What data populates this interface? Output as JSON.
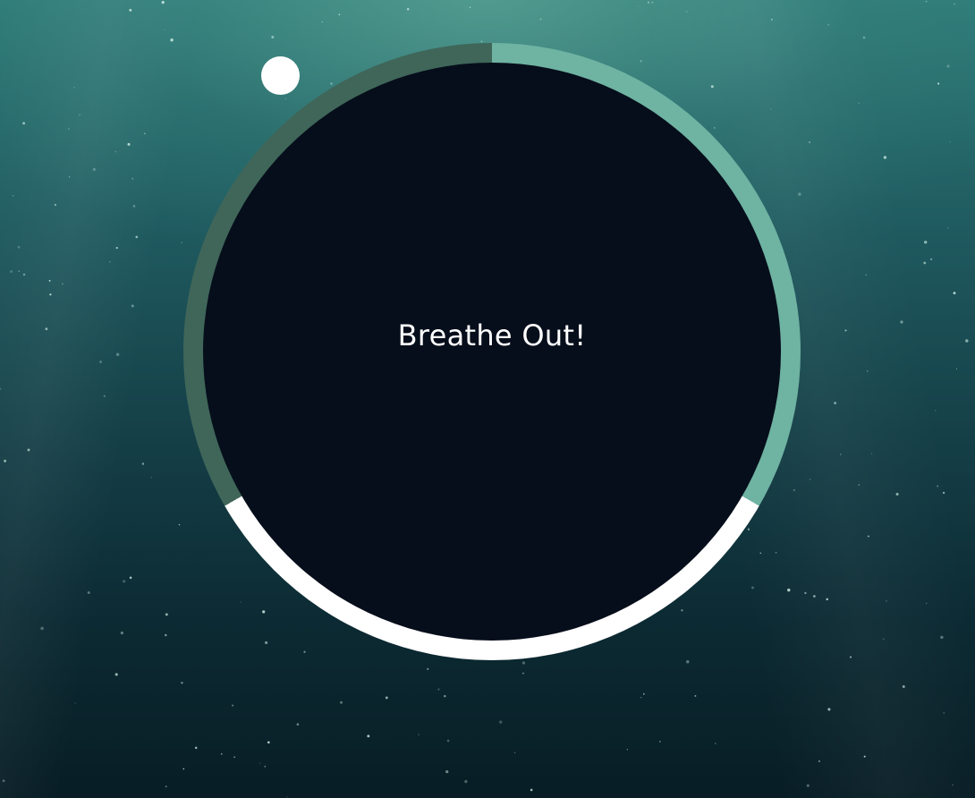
{
  "breathing": {
    "phase_text": "Breathe Out!",
    "segments": [
      {
        "phase": "breathe-in",
        "color": "#6fb3a2"
      },
      {
        "phase": "hold",
        "color": "#ffffff"
      },
      {
        "phase": "breathe-out",
        "color": "#3f6659"
      }
    ],
    "pointer_color": "#ffffff",
    "circle_color": "#060e1b"
  },
  "background": {
    "top_color": "#2f7d7a",
    "bottom_color": "#081d25"
  }
}
